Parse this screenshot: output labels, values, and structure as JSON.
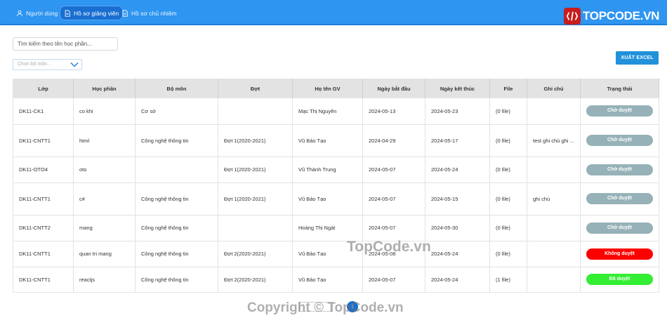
{
  "nav": {
    "tabs": [
      {
        "label": "Người dùng",
        "icon": "users-icon"
      },
      {
        "label": "Hồ sơ giảng viên",
        "icon": "document-icon"
      },
      {
        "label": "Hồ sơ chủ nhiệm",
        "icon": "document-icon"
      }
    ],
    "active_tab": 1,
    "brand": "TOPCODE.VN"
  },
  "filters": {
    "search_placeholder": "Tìm kiếm theo tên học phần...",
    "department_placeholder": "Chọn bộ môn..."
  },
  "toolbar": {
    "export_label": "XUẤT EXCEL"
  },
  "table": {
    "columns": [
      "Lớp",
      "Học phần",
      "Bộ môn",
      "Đợt",
      "Họ tên GV",
      "Ngày bắt đầu",
      "Ngày kết thúc",
      "File",
      "Ghi chú",
      "Trạng thái"
    ],
    "rows": [
      {
        "lop": "DK11-CK1",
        "hoc_phan": "co khi",
        "bo_mon": "Cơ sở",
        "dot": "",
        "gv": "Mạc Thị Nguyên",
        "start": "2024-05-13",
        "end": "2024-05-23",
        "file": "(0 file)",
        "ghi_chu": "",
        "status": "Chờ duyệt",
        "status_kind": "pending"
      },
      {
        "lop": "DK11-CNTT1",
        "hoc_phan": "html",
        "bo_mon": "Công nghệ thông tin",
        "dot": "Đợt 1(2020-2021)",
        "gv": "Vũ Bảo Tạo",
        "start": "2024-04-29",
        "end": "2024-05-17",
        "file": "(0 file)",
        "ghi_chu": "test ghi chú ghi ...",
        "status": "Chờ duyệt",
        "status_kind": "pending"
      },
      {
        "lop": "DK11-OTO4",
        "hoc_phan": "oto",
        "bo_mon": "",
        "dot": "Đợt 1(2020-2021)",
        "gv": "Vũ Thành Trung",
        "start": "2024-05-07",
        "end": "2024-05-24",
        "file": "(0 file)",
        "ghi_chu": "",
        "status": "Chờ duyệt",
        "status_kind": "pending"
      },
      {
        "lop": "DK11-CNTT1",
        "hoc_phan": "c#",
        "bo_mon": "Công nghệ thông tin",
        "dot": "Đợt 1(2020-2021)",
        "gv": "Vũ Bảo Tạo",
        "start": "2024-05-07",
        "end": "2024-05-15",
        "file": "(0 file)",
        "ghi_chu": "ghi chú",
        "status": "Chờ duyệt",
        "status_kind": "pending"
      },
      {
        "lop": "DK11-CNTT2",
        "hoc_phan": "mang",
        "bo_mon": "Công nghệ thông tin",
        "dot": "",
        "gv": "Hoàng Thị Ngát",
        "start": "2024-05-07",
        "end": "2024-05-30",
        "file": "(0 file)",
        "ghi_chu": "",
        "status": "Chờ duyệt",
        "status_kind": "pending"
      },
      {
        "lop": "DK11-CNTT1",
        "hoc_phan": "quan tri mang",
        "bo_mon": "Công nghệ thông tin",
        "dot": "Đợt 2(2020-2021)",
        "gv": "Vũ Bảo Tạo",
        "start": "2024-05-08",
        "end": "2024-05-24",
        "file": "(0 file)",
        "ghi_chu": "",
        "status": "Không duyệt",
        "status_kind": "rejected"
      },
      {
        "lop": "DK11-CNTT1",
        "hoc_phan": "reactjs",
        "bo_mon": "Công nghệ thông tin",
        "dot": "Đợt 2(2020-2021)",
        "gv": "Vũ Bảo Tạo",
        "start": "2024-05-07",
        "end": "2024-05-24",
        "file": "(1 file)",
        "ghi_chu": "",
        "status": "Đã duyệt",
        "status_kind": "approved"
      }
    ]
  },
  "status_colors": {
    "pending": "#96b2b8",
    "rejected": "#ff0000",
    "approved": "#33ee33"
  },
  "pagination": {
    "current_page": "1"
  },
  "watermarks": [
    "TopCode.vn",
    "Copyright © TopCode.vn"
  ],
  "colors": {
    "topbar": "#2e95f0",
    "accent": "#1a6fd1",
    "export": "#2191da"
  }
}
